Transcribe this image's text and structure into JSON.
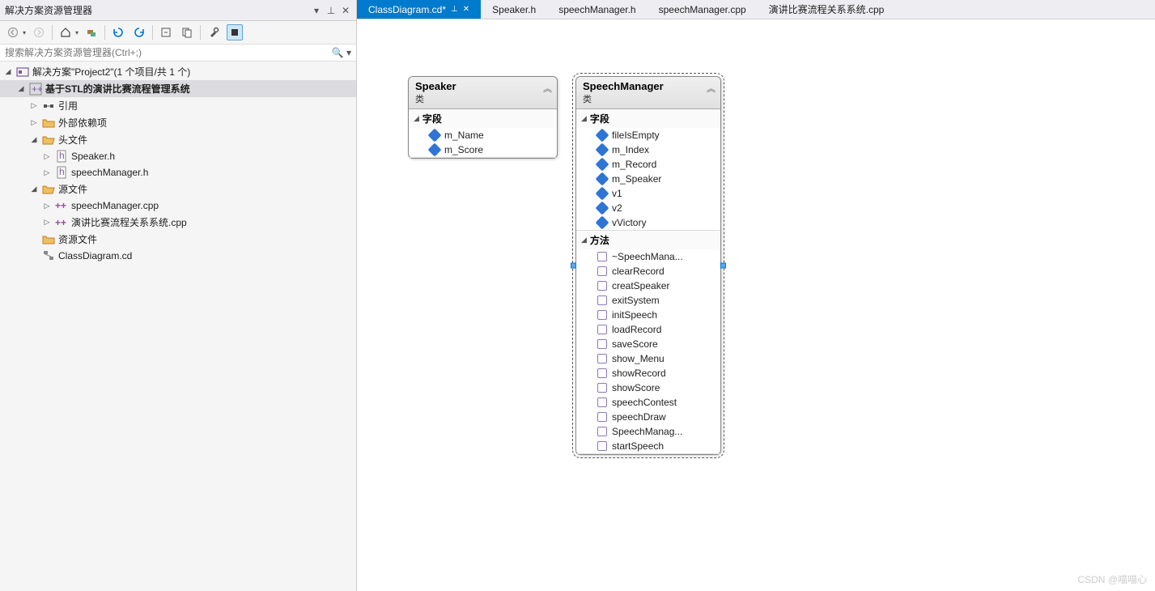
{
  "panel": {
    "title": "解决方案资源管理器"
  },
  "search": {
    "placeholder": "搜索解决方案资源管理器(Ctrl+;)"
  },
  "tree": {
    "solution": "解决方案\"Project2\"(1 个项目/共 1 个)",
    "project": "基于STL的演讲比赛流程管理系统",
    "refs": "引用",
    "ext": "外部依赖项",
    "headers": "头文件",
    "hdr_files": [
      "Speaker.h",
      "speechManager.h"
    ],
    "sources": "源文件",
    "src_files": [
      "speechManager.cpp",
      "演讲比赛流程关系系统.cpp"
    ],
    "resources": "资源文件",
    "classdiag": "ClassDiagram.cd"
  },
  "tabs": {
    "active": "ClassDiagram.cd*",
    "others": [
      "Speaker.h",
      "speechManager.h",
      "speechManager.cpp",
      "演讲比赛流程关系系统.cpp"
    ]
  },
  "sections": {
    "fields": "字段",
    "methods": "方法",
    "classSub": "类"
  },
  "diagram": {
    "speaker": {
      "name": "Speaker",
      "fields": [
        "m_Name",
        "m_Score"
      ]
    },
    "speechmgr": {
      "name": "SpeechManager",
      "fields": [
        "fileIsEmpty",
        "m_Index",
        "m_Record",
        "m_Speaker",
        "v1",
        "v2",
        "vVictory"
      ],
      "methods": [
        "~SpeechMana...",
        "clearRecord",
        "creatSpeaker",
        "exitSystem",
        "initSpeech",
        "loadRecord",
        "saveScore",
        "show_Menu",
        "showRecord",
        "showScore",
        "speechContest",
        "speechDraw",
        "SpeechManag...",
        "startSpeech"
      ]
    }
  },
  "watermark": "CSDN @喵喵心"
}
